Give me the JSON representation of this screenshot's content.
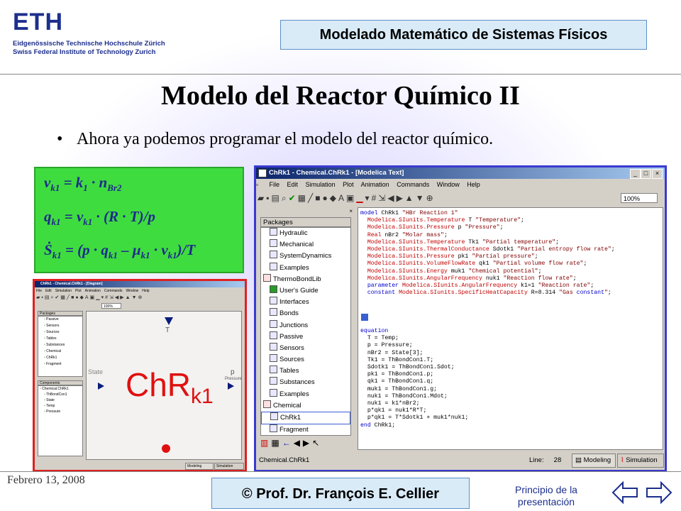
{
  "header": {
    "logo_text": "ETH",
    "logo_line1": "Eidgenössische Technische Hochschule Zürich",
    "logo_line2": "Swiss Federal Institute of Technology Zurich",
    "course_title": "Modelado Matemático de Sistemas Físicos"
  },
  "slide": {
    "title": "Modelo del Reactor Químico II",
    "bullet": "Ahora ya podemos programar el modelo del reactor químico."
  },
  "equations": {
    "eq1_lhs": "ν",
    "eq1_lhs_sub": "k1",
    "eq1_rhs": "= k",
    "eq1_rhs_sub": "1",
    "eq1_rhs2": " · n",
    "eq1_rhs2_sub": "Br2",
    "eq2_lhs": "q",
    "eq2_lhs_sub": "k1",
    "eq2_rhs": "= ν",
    "eq2_rhs_sub": "k1",
    "eq2_rhs2": " · (R · T)/p",
    "eq3_lhs": "Ṡ",
    "eq3_lhs_sub": "k1",
    "eq3_rhs": "= (p · q",
    "eq3_rhs_sub": "k1",
    "eq3_rhs2": " – μ",
    "eq3_rhs2_sub": "k1",
    "eq3_rhs3": " · ν",
    "eq3_rhs3_sub": "k1",
    "eq3_rhs4": ")/T"
  },
  "text_window": {
    "title": "ChRk1 - Chemical.ChRk1 - [Modelica Text]",
    "menu": [
      "File",
      "Edit",
      "Simulation",
      "Plot",
      "Animation",
      "Commands",
      "Window",
      "Help"
    ],
    "zoom": "100%",
    "packages_label": "Packages",
    "tree": [
      {
        "label": "Hydraulic",
        "depth": 1
      },
      {
        "label": "Mechanical",
        "depth": 1
      },
      {
        "label": "SystemDynamics",
        "depth": 1
      },
      {
        "label": "Examples",
        "depth": 1
      },
      {
        "label": "ThermoBondLib",
        "depth": 0
      },
      {
        "label": "User's Guide",
        "depth": 1
      },
      {
        "label": "Interfaces",
        "depth": 1
      },
      {
        "label": "Bonds",
        "depth": 1
      },
      {
        "label": "Junctions",
        "depth": 1
      },
      {
        "label": "Passive",
        "depth": 1
      },
      {
        "label": "Sensors",
        "depth": 1
      },
      {
        "label": "Sources",
        "depth": 1
      },
      {
        "label": "Tables",
        "depth": 1
      },
      {
        "label": "Substances",
        "depth": 1
      },
      {
        "label": "Examples",
        "depth": 1
      },
      {
        "label": "Chemical",
        "depth": 0
      },
      {
        "label": "ChRk1",
        "depth": 1
      },
      {
        "label": "Fragment",
        "depth": 1
      }
    ],
    "code_decl": [
      "model ChRk1 \"HBr Reaction 1\"",
      "  Modelica.SIunits.Temperature T \"Temperature\";",
      "  Modelica.SIunits.Pressure p \"Pressure\";",
      "  Real nBr2 \"Molar mass\";",
      "  Modelica.SIunits.Temperature Tk1 \"Partial temperature\";",
      "  Modelica.SIunits.ThermalConductance Sdotk1 \"Partial entropy flow rate\";",
      "  Modelica.SIunits.Pressure pk1 \"Partial pressure\";",
      "  Modelica.SIunits.VolumeFlowRate qk1 \"Partial volume flow rate\";",
      "  Modelica.SIunits.Energy muk1 \"Chemical potential\";",
      "  Modelica.SIunits.AngularFrequency nuk1 \"Reaction flow rate\";",
      "  parameter Modelica.SIunits.AngularFrequency k1=1 \"Reaction rate\";",
      "  constant Modelica.SIunits.SpecificHeatCapacity R=8.314 \"Gas constant\";"
    ],
    "code_eq": [
      "equation",
      "  T = Temp;",
      "  p = Pressure;",
      "  nBr2 = State[3];",
      "  Tk1 = ThBondCon1.T;",
      "  Sdotk1 = ThBondCon1.Sdot;",
      "  pk1 = ThBondCon1.p;",
      "  qk1 = ThBondCon1.q;",
      "  muk1 = ThBondCon1.g;",
      "  nuk1 = ThBondCon1.Mdot;",
      "  nuk1 = k1*nBr2;",
      "  p*qk1 = nuk1*R*T;",
      "  p*qk1 = T*Sdotk1 + muk1*nuk1;",
      "end ChRk1;"
    ],
    "status_left": "Chemical.ChRk1",
    "status_line_label": "Line:",
    "status_line_value": "28",
    "tab_modeling": "Modeling",
    "tab_simulation": "Simulation"
  },
  "diagram_window": {
    "title": "ChRk1 - Chemical.ChRk1 - [Diagram]",
    "zoom": "100%",
    "packages_label": "Packages",
    "tree": [
      "Passive",
      "Sensors",
      "Sources",
      "Tables",
      "Substances",
      "Chemical",
      "ChRk1",
      "Fragment"
    ],
    "components_label": "Components",
    "components": [
      "Chemical.ChRk1",
      "ThBondCon1",
      "State",
      "Temp",
      "Pressure"
    ],
    "icon_text": "ChR",
    "icon_sub": "k1",
    "label_T": "T",
    "label_state": "State",
    "label_p": "p",
    "label_pressure": "Pressure",
    "tab_modeling": "Modeling",
    "tab_simulation": "Simulation"
  },
  "footer": {
    "date": "Febrero 13, 2008",
    "author": "© Prof. Dr. François E. Cellier",
    "back_link": "Principio de la presentación"
  },
  "colors": {
    "accent_blue": "#1d2f8c",
    "eq_box": "#3fdc3f",
    "text_window_border": "#3a3ad0",
    "diagram_window_border": "#e02020"
  }
}
